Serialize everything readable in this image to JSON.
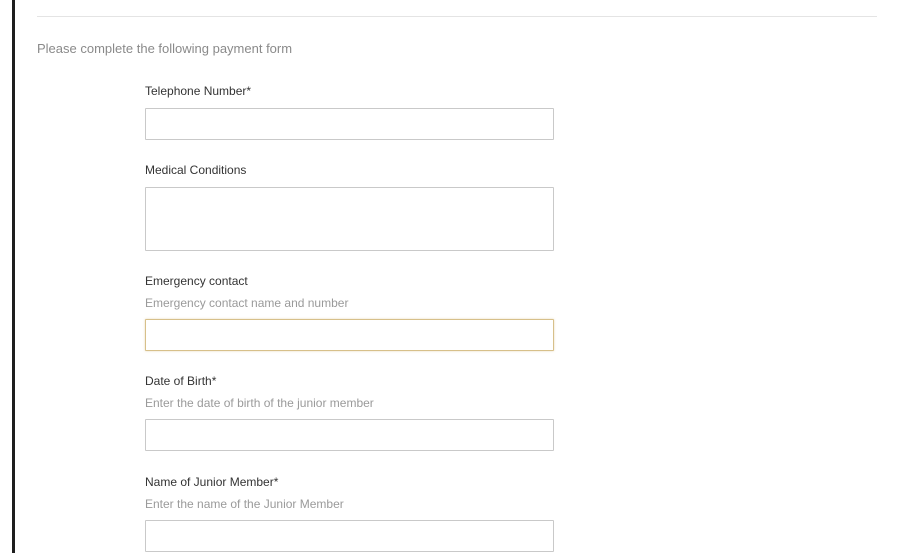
{
  "form": {
    "intro": "Please complete the following payment form",
    "telephone": {
      "label": "Telephone Number*",
      "value": ""
    },
    "medical": {
      "label": "Medical Conditions",
      "value": ""
    },
    "emergency": {
      "label": "Emergency contact",
      "help": "Emergency contact name and number",
      "value": ""
    },
    "dob": {
      "label": "Date of Birth*",
      "help": "Enter the date of birth of the junior member",
      "value": ""
    },
    "junior_name": {
      "label": "Name of Junior Member*",
      "help": "Enter the name of the Junior Member",
      "value": ""
    }
  },
  "colors": {
    "focus_border": "#d7c08a",
    "input_border": "#c9c9c9",
    "left_border": "#1e1e1e"
  }
}
